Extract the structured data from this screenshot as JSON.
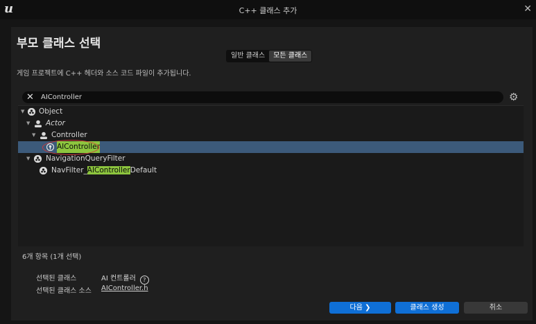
{
  "window": {
    "title": "C++ 클래스 추가",
    "logo": "u"
  },
  "heading": "부모 클래스 선택",
  "class_tabs": [
    {
      "label": "일반 클래스",
      "active": false
    },
    {
      "label": "모든 클래스",
      "active": true
    }
  ],
  "description": "게임 프로젝트에 C++ 헤더와 소스 코드 파일이 추가됩니다.",
  "search": {
    "value": "AIController"
  },
  "tree": {
    "items": [
      {
        "label": "Object"
      },
      {
        "label": "Actor"
      },
      {
        "label": "Controller"
      },
      {
        "label": "AIController"
      },
      {
        "label": "NavigationQueryFilter"
      },
      {
        "label_prefix": "NavFilter_",
        "label_highlight": "AIController",
        "label_suffix": "Default"
      }
    ]
  },
  "status_count": "6개 항목 (1개 선택)",
  "selected": {
    "class_label": "선택된 클래스",
    "class_value": "AI 컨트롤러",
    "source_label": "선택된 클래스 소스",
    "source_value": "AIController.h"
  },
  "buttons": {
    "next": "다음",
    "create": "클래스 생성",
    "cancel": "취소"
  },
  "colors": {
    "accent": "#0f6fd6",
    "selection": "#3c5a7a",
    "highlight": "#8dc53e",
    "annotation": "#d23a3a"
  }
}
